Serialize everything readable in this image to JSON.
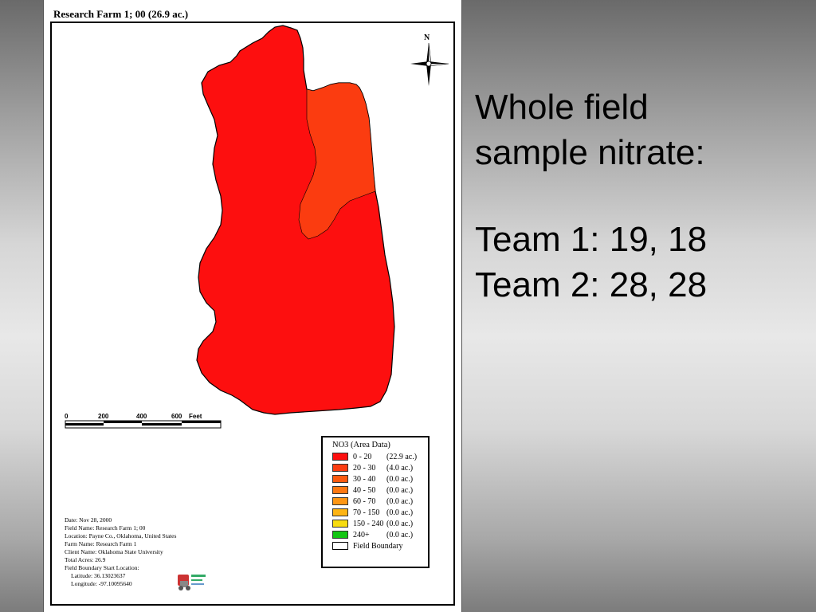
{
  "map": {
    "title": "Research Farm 1; 00 (26.9 ac.)",
    "north_label": "N",
    "scale": {
      "ticks": [
        "0",
        "200",
        "400",
        "600"
      ],
      "unit": "Feet"
    },
    "field": {
      "fill_low": "#fd0f0f",
      "fill_mid": "#fb3c10"
    },
    "legend": {
      "title": "NO3 (Area Data)",
      "entries": [
        {
          "range": "0 - 20",
          "area": "(22.9 ac.)",
          "color": "#fd0f0f"
        },
        {
          "range": "20 - 30",
          "area": "(4.0 ac.)",
          "color": "#fb3c10"
        },
        {
          "range": "30 - 40",
          "area": "(0.0 ac.)",
          "color": "#fb5a10"
        },
        {
          "range": "40 - 50",
          "area": "(0.0 ac.)",
          "color": "#fc7812"
        },
        {
          "range": "60 - 70",
          "area": "(0.0 ac.)",
          "color": "#fd9614"
        },
        {
          "range": "70 - 150",
          "area": "(0.0 ac.)",
          "color": "#fdb414"
        },
        {
          "range": "150 - 240",
          "area": "(0.0 ac.)",
          "color": "#f7dc10"
        },
        {
          "range": "240+",
          "area": "(0.0 ac.)",
          "color": "#12c612"
        }
      ],
      "boundary_label": "Field Boundary"
    },
    "info": {
      "date": "Date: Nov 28, 2000",
      "field_name": "Field Name: Research Farm 1; 00",
      "location": "Location:  Payne Co., Oklahoma, United States",
      "farm_name": "Farm Name: Research Farm 1",
      "client_name": "Client Name: Oklahoma State University",
      "total_acres": "Total Acres: 26.9",
      "boundary_start": "Field Boundary Start Location:",
      "latitude": "Latitude: 36.13023637",
      "longitude": "Longitude: -97.10095640"
    }
  },
  "slide": {
    "heading_line1": "Whole field",
    "heading_line2": "sample nitrate:",
    "team1": "Team 1: 19, 18",
    "team2": "Team 2: 28, 28"
  }
}
